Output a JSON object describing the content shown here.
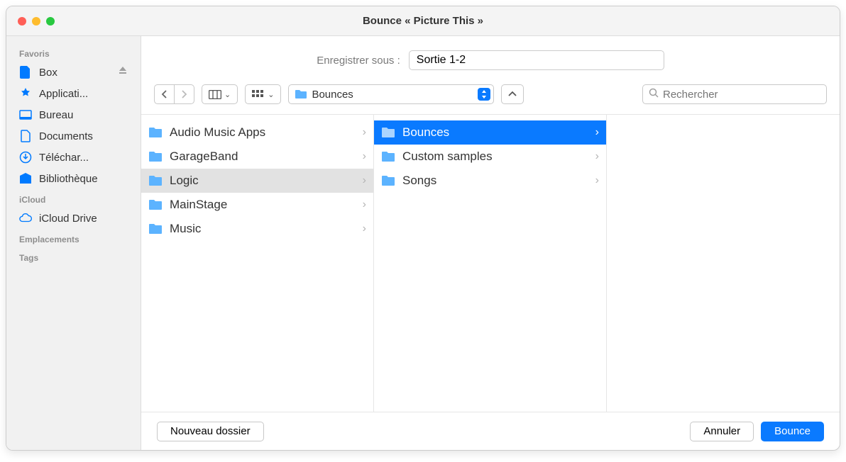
{
  "window_title": "Bounce « Picture This »",
  "save": {
    "label": "Enregistrer sous :",
    "value": "Sortie 1-2"
  },
  "location": {
    "name": "Bounces"
  },
  "search": {
    "placeholder": "Rechercher"
  },
  "sidebar": {
    "favorites_heading": "Favoris",
    "icloud_heading": "iCloud",
    "locations_heading": "Emplacements",
    "tags_heading": "Tags",
    "favorites": [
      {
        "label": "Box",
        "icon": "document",
        "ejectable": true
      },
      {
        "label": "Applicati...",
        "icon": "apps"
      },
      {
        "label": "Bureau",
        "icon": "desktop"
      },
      {
        "label": "Documents",
        "icon": "document"
      },
      {
        "label": "Téléchar...",
        "icon": "download"
      },
      {
        "label": "Bibliothèque",
        "icon": "library"
      }
    ],
    "icloud": [
      {
        "label": "iCloud Drive",
        "icon": "cloud"
      }
    ]
  },
  "columns": [
    {
      "items": [
        {
          "name": "Audio Music Apps",
          "selected": false
        },
        {
          "name": "GarageBand",
          "selected": false
        },
        {
          "name": "Logic",
          "selected": true
        },
        {
          "name": "MainStage",
          "selected": false
        },
        {
          "name": "Music",
          "selected": false
        }
      ]
    },
    {
      "items": [
        {
          "name": "Bounces",
          "selected": true
        },
        {
          "name": "Custom samples",
          "selected": false
        },
        {
          "name": "Songs",
          "selected": false
        }
      ]
    }
  ],
  "footer": {
    "new_folder": "Nouveau dossier",
    "cancel": "Annuler",
    "confirm": "Bounce"
  }
}
